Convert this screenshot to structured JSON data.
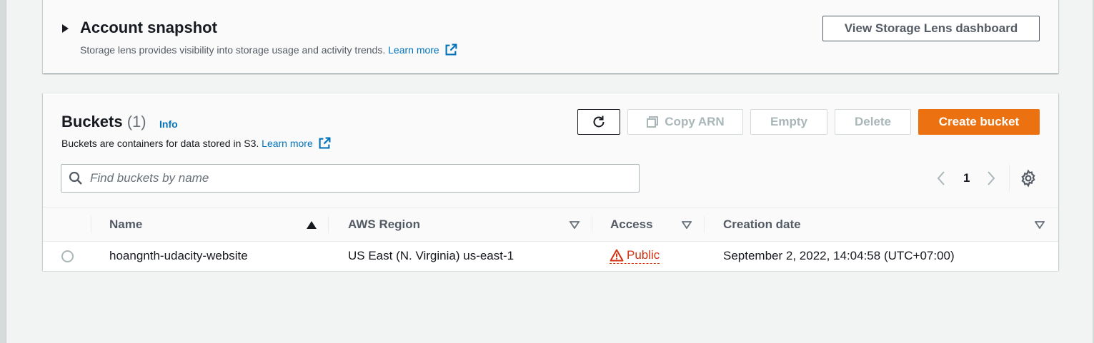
{
  "snapshot": {
    "title": "Account snapshot",
    "description": "Storage lens provides visibility into storage usage and activity trends.",
    "learn_more": "Learn more",
    "lens_button": "View Storage Lens dashboard"
  },
  "buckets": {
    "title": "Buckets",
    "count": "(1)",
    "info": "Info",
    "description": "Buckets are containers for data stored in S3.",
    "learn_more": "Learn more",
    "actions": {
      "copy_arn": "Copy ARN",
      "empty": "Empty",
      "delete": "Delete",
      "create": "Create bucket"
    },
    "search_placeholder": "Find buckets by name",
    "page": "1",
    "columns": {
      "name": "Name",
      "region": "AWS Region",
      "access": "Access",
      "creation": "Creation date"
    },
    "rows": [
      {
        "name": "hoangnth-udacity-website",
        "region": "US East (N. Virginia) us-east-1",
        "access": "Public",
        "creation": "September 2, 2022, 14:04:58 (UTC+07:00)"
      }
    ]
  },
  "colors": {
    "primary": "#ec7211",
    "link": "#0073bb",
    "warning": "#d13212",
    "disabled": "#aab7b8"
  }
}
